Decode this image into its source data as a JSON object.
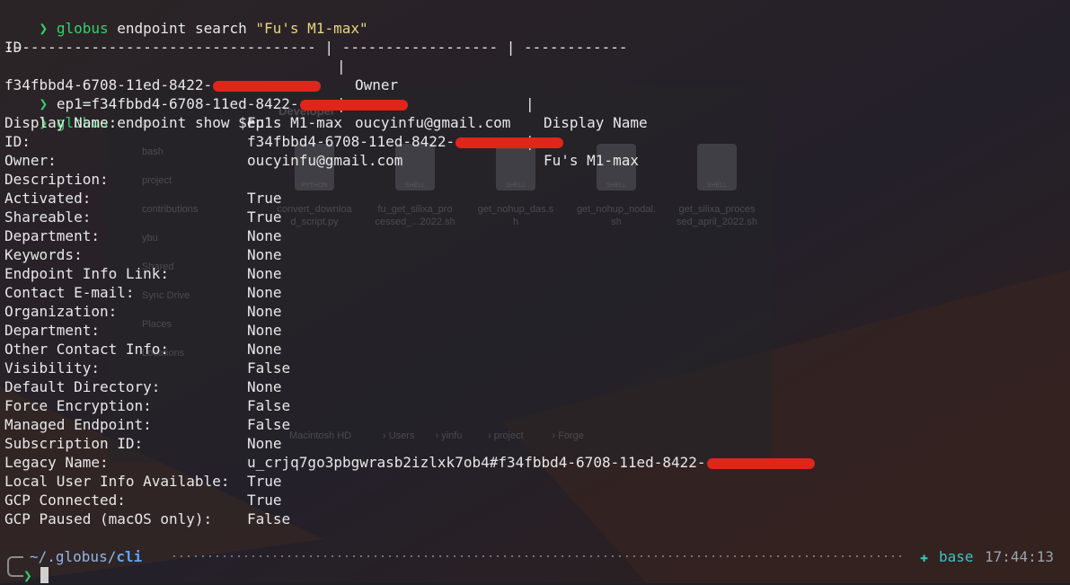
{
  "prompt_symbol": "❯",
  "search_cmd": {
    "program": "globus",
    "args": " endpoint search ",
    "query": "\"Fu's M1-max\""
  },
  "table": {
    "headers": [
      "ID",
      "Owner",
      "Display Name"
    ],
    "separator": "------------------------------------ | ------------------ | ------------",
    "row": {
      "id_visible": "f34fbbd4-6708-11ed-8422-",
      "owner": "oucyinfu@gmail.com",
      "display": "Fu's M1-max"
    }
  },
  "assign_cmd": "ep1=f34fbbd4-6708-11ed-8422-",
  "show_cmd": {
    "program": "globus",
    "args": " endpoint show $ep1"
  },
  "details": [
    {
      "key": "Display Name:",
      "value": "Fu's M1-max"
    },
    {
      "key": "ID:",
      "value": "f34fbbd4-6708-11ed-8422-"
    },
    {
      "key": "Owner:",
      "value": "oucyinfu@gmail.com"
    },
    {
      "key": "Description:",
      "value": ""
    },
    {
      "key": "Activated:",
      "value": "True"
    },
    {
      "key": "Shareable:",
      "value": "True"
    },
    {
      "key": "Department:",
      "value": "None"
    },
    {
      "key": "Keywords:",
      "value": "None"
    },
    {
      "key": "Endpoint Info Link:",
      "value": "None"
    },
    {
      "key": "Contact E-mail:",
      "value": "None"
    },
    {
      "key": "Organization:",
      "value": "None"
    },
    {
      "key": "Department:",
      "value": "None"
    },
    {
      "key": "Other Contact Info:",
      "value": "None"
    },
    {
      "key": "Visibility:",
      "value": "False"
    },
    {
      "key": "Default Directory:",
      "value": "None"
    },
    {
      "key": "Force Encryption:",
      "value": "False"
    },
    {
      "key": "Managed Endpoint:",
      "value": "False"
    },
    {
      "key": "Subscription ID:",
      "value": "None"
    },
    {
      "key": "Legacy Name:",
      "value": "u_crjq7go3pbgwrasb2izlxk7ob4#f34fbbd4-6708-11ed-8422-"
    },
    {
      "key": "Local User Info Available:",
      "value": "True"
    },
    {
      "key": "GCP Connected:",
      "value": "True"
    },
    {
      "key": "GCP Paused (macOS only):",
      "value": "False"
    }
  ],
  "statusline": {
    "cwd_prefix": "~/.globus/",
    "cwd_last": "cli",
    "env_icon": "python-env-icon",
    "env_name": "base",
    "time": "17:44:13"
  },
  "colors": {
    "background": "#1f2024",
    "prompt_green": "#35d06b",
    "string_yellow": "#e9d37f",
    "redaction_red": "#e0251b",
    "path_blue": "#5aa7ff",
    "env_cyan": "#38c5c0"
  },
  "backdrop": {
    "folder_title": "Developer",
    "sidebar_items": [
      "gs",
      "bash",
      "project",
      "contributions",
      "ybu",
      "Shared",
      "Sync Drive",
      "Places",
      "Locations"
    ],
    "files": [
      {
        "type": "PYTHON",
        "name": [
          "convert_downloa",
          "d_script.py"
        ]
      },
      {
        "type": "SHELL",
        "name": [
          "fu_get_silixa_pro",
          "cessed_...2022.sh"
        ]
      },
      {
        "type": "SHELL",
        "name": [
          "get_nohup_das.s",
          "h"
        ]
      },
      {
        "type": "SHELL",
        "name": [
          "get_nohup_nodal.",
          "sh"
        ]
      },
      {
        "type": "SHELL",
        "name": [
          "get_silixa_proces",
          "sed_april_2022.sh"
        ]
      }
    ],
    "path_bar": [
      "Macintosh HD",
      "Users",
      "yinfu",
      "project",
      "Forge"
    ]
  }
}
